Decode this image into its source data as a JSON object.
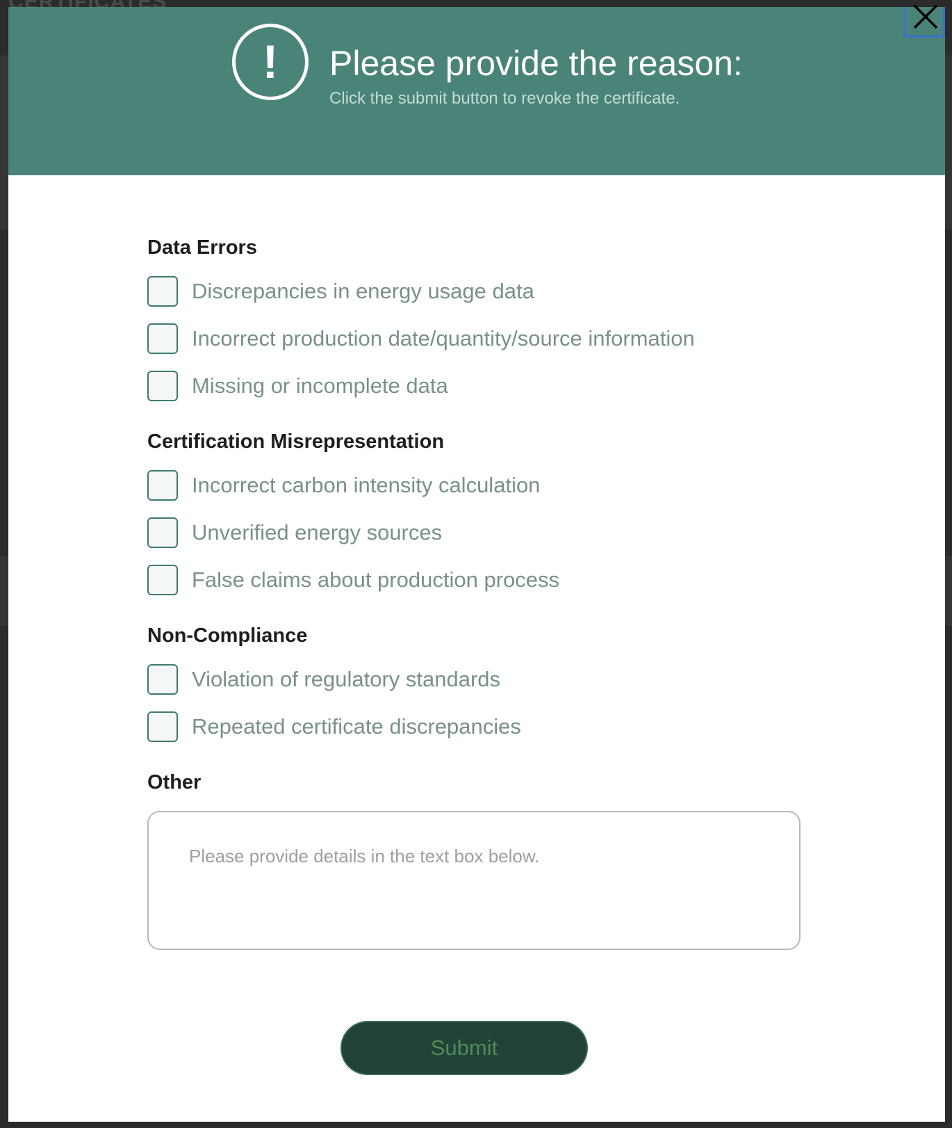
{
  "background": {
    "page_title": "CERTIFICATES"
  },
  "header": {
    "icon": "alert-circle-icon",
    "title": "Please provide the reason:",
    "subtitle": "Click the submit button to revoke the certificate.",
    "background_color": "#4a8479"
  },
  "close_button": {
    "icon": "close-icon"
  },
  "sections": [
    {
      "heading": "Data Errors",
      "options": [
        "Discrepancies in energy usage data",
        "Incorrect production date/quantity/source information",
        "Missing or incomplete data"
      ]
    },
    {
      "heading": "Certification Misrepresentation",
      "options": [
        "Incorrect carbon intensity calculation",
        "Unverified energy sources",
        "False claims about production process"
      ]
    },
    {
      "heading": "Non-Compliance",
      "options": [
        "Violation of regulatory standards",
        "Repeated certificate discrepancies"
      ]
    }
  ],
  "other": {
    "heading": "Other",
    "placeholder": "Please provide details in the text box below.",
    "value": ""
  },
  "submit": {
    "label": "Submit",
    "background_color": "#224238"
  }
}
